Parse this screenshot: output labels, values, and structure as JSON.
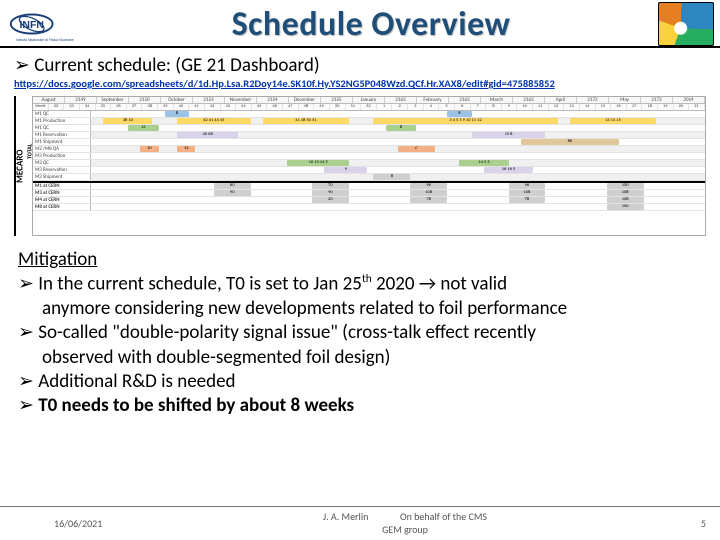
{
  "header": {
    "title": "Schedule Overview",
    "logo_left_caption": "Istituto Nazionale di Fisica Nucleare"
  },
  "intro": {
    "bullet_prefix": "➢",
    "line": "Current schedule: (GE 21 Dashboard)",
    "link": "https://docs.google.com/spreadsheets/d/1d.Hp.Lsa.R2Doy14e.SK10f.Hy.YS2NG5P048Wzd.QCf.Hr.XAX8/edit#gid=475885852"
  },
  "gantt": {
    "side_label": "MECARO",
    "months": [
      "August",
      "2149",
      "September",
      "2150",
      "October",
      "2153",
      "November",
      "2154",
      "December",
      "2155",
      "January",
      "2163",
      "February",
      "2163",
      "March",
      "2163",
      "April",
      "2172",
      "May",
      "2173",
      "2014"
    ],
    "weeks": [
      "Week",
      "32",
      "33",
      "34",
      "35",
      "36",
      "37",
      "38",
      "39",
      "40",
      "41",
      "42",
      "43",
      "44",
      "45",
      "46",
      "47",
      "48",
      "49",
      "50",
      "51",
      "52",
      "1",
      "2",
      "3",
      "4",
      "5",
      "6",
      "7",
      "8",
      "9",
      "10",
      "11",
      "12",
      "13",
      "14",
      "15",
      "16",
      "17",
      "18",
      "19",
      "20",
      "21"
    ],
    "rows": [
      {
        "label": "M1 QC",
        "bars": [
          {
            "cls": "c-blue",
            "l": 12,
            "w": 4,
            "t": "8"
          },
          {
            "cls": "c-blue",
            "l": 58,
            "w": 4,
            "t": "8"
          }
        ]
      },
      {
        "label": "M1 Production",
        "bars": [
          {
            "cls": "c-gold",
            "l": 2,
            "w": 8,
            "t": "38  10"
          },
          {
            "cls": "c-gold",
            "l": 14,
            "w": 12,
            "t": "42  41  44  45"
          },
          {
            "cls": "c-gold",
            "l": 28,
            "w": 14,
            "t": "41  48  50  51"
          },
          {
            "cls": "c-gold",
            "l": 46,
            "w": 30,
            "t": "3  4  5  5  9  10  11  12"
          },
          {
            "cls": "c-gold",
            "l": 78,
            "w": 14,
            "t": "13  14  15"
          }
        ]
      },
      {
        "label": "M1 QC",
        "bars": [
          {
            "cls": "c-grn",
            "l": 6,
            "w": 5,
            "t": "13"
          },
          {
            "cls": "c-grn",
            "l": 48,
            "w": 5,
            "t": "8"
          }
        ]
      },
      {
        "label": "M1 Reservation",
        "bars": [
          {
            "cls": "c-lav",
            "l": 14,
            "w": 10,
            "t": "40  68"
          },
          {
            "cls": "c-lav",
            "l": 62,
            "w": 12,
            "t": "15  8"
          }
        ]
      },
      {
        "label": "M1 Shipment",
        "bars": [
          {
            "cls": "c-tan",
            "l": 70,
            "w": 16,
            "t": "86"
          }
        ]
      },
      {
        "label": "M2 /M8  QA",
        "bars": [
          {
            "cls": "c-pnk",
            "l": 8,
            "w": 3,
            "t": "10"
          },
          {
            "cls": "c-pnk",
            "l": 14,
            "w": 3,
            "t": "13"
          },
          {
            "cls": "c-pnk",
            "l": 50,
            "w": 6,
            "t": "C"
          }
        ]
      },
      {
        "label": "M3 Production",
        "bars": []
      },
      {
        "label": "M3 QC",
        "bars": [
          {
            "cls": "c-grn",
            "l": 32,
            "w": 10,
            "t": "10  13  14  5"
          },
          {
            "cls": "c-grn",
            "l": 60,
            "w": 8,
            "t": "14  5  3"
          }
        ]
      },
      {
        "label": "M3 Reservation",
        "bars": [
          {
            "cls": "c-lav",
            "l": 38,
            "w": 7,
            "t": "9"
          },
          {
            "cls": "c-lav",
            "l": 64,
            "w": 8,
            "t": "16  16  5"
          }
        ]
      },
      {
        "label": "M3 Shipment",
        "bars": [
          {
            "cls": "c-gry",
            "l": 46,
            "w": 6,
            "t": "8"
          }
        ]
      }
    ],
    "totals": [
      {
        "label": "M1 at CERN",
        "cells": [
          "60",
          "70",
          "96",
          "96",
          "150"
        ]
      },
      {
        "label": "M3 at CERN",
        "cells": [
          "90",
          "90",
          "108",
          "108",
          "108"
        ]
      },
      {
        "label": "M4 at CERN",
        "cells": [
          "",
          "20",
          "78",
          "78",
          "108"
        ]
      },
      {
        "label": "M8 at CERN",
        "cells": [
          "",
          "",
          "",
          "",
          "100"
        ]
      }
    ],
    "total_label": "TOTAL"
  },
  "mitigation": {
    "heading": "Mitigation",
    "b1a": "In the current schedule, T0 is set to Jan 25",
    "b1sup": "th",
    "b1b": " 2020 ",
    "b1arrow": "→",
    "b1c": " not valid",
    "b1d": "anymore considering new developments related to foil performance",
    "b2a": "So-called \"double-polarity signal issue\" (cross-talk effect recently",
    "b2b": "observed with double-segmented foil design)",
    "b3": "Additional R&D is needed",
    "b4": "T0 needs to be shifted by about 8 weeks"
  },
  "footer": {
    "date": "16/06/2021",
    "author": "J. A. Merlin",
    "group": "GEM group",
    "behalf": "On behalf of the CMS",
    "page": "5"
  }
}
